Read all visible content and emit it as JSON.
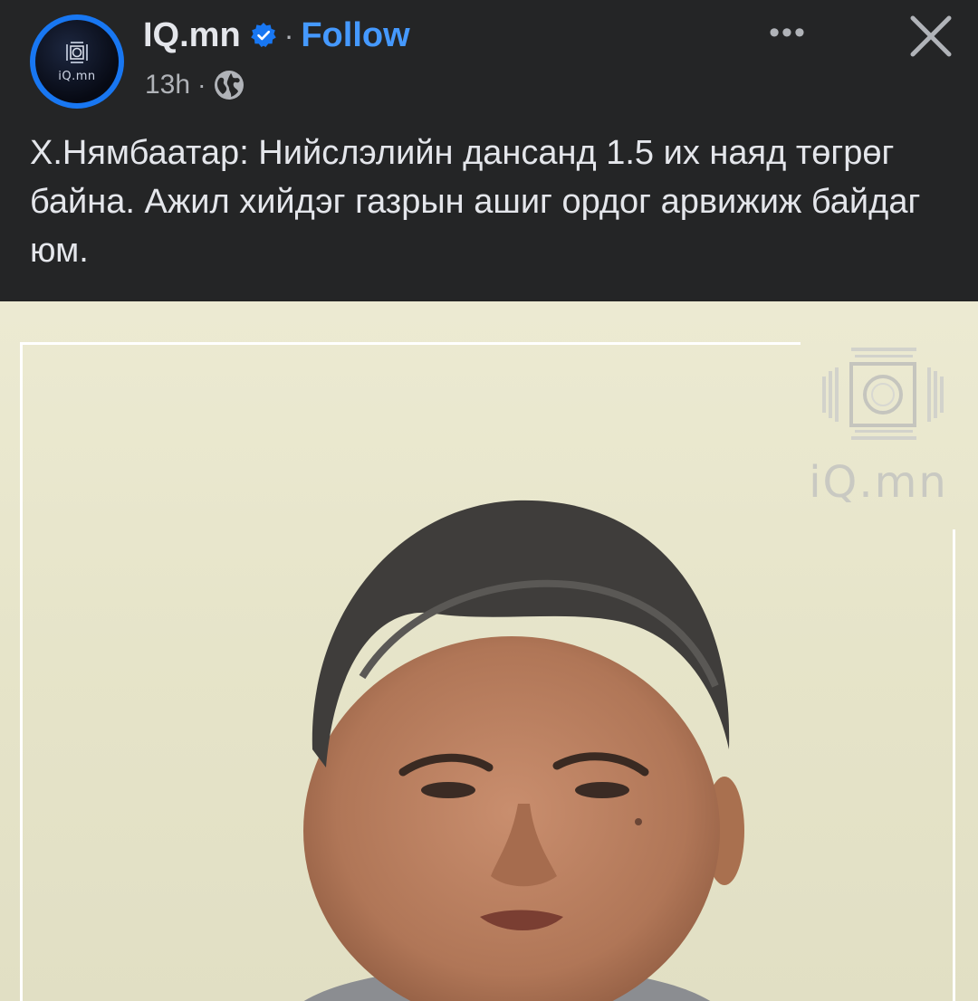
{
  "post": {
    "author": "IQ.mn",
    "avatar_text": "iQ.mn",
    "separator": "·",
    "follow_label": "Follow",
    "time": "13h",
    "meta_separator": "·",
    "more_label": "•••",
    "caption": "Х.Нямбаатар: Нийслэлийн дансанд 1.5 их наяд төгрөг байна. Ажил хийдэг газрын ашиг ордог арвижиж байдаг юм."
  },
  "media": {
    "watermark_text": "iQ.mn"
  },
  "colors": {
    "background": "#242526",
    "accent": "#4599ff",
    "verified": "#1877f2",
    "text": "#e4e6eb",
    "secondary_text": "#b0b3b8"
  }
}
